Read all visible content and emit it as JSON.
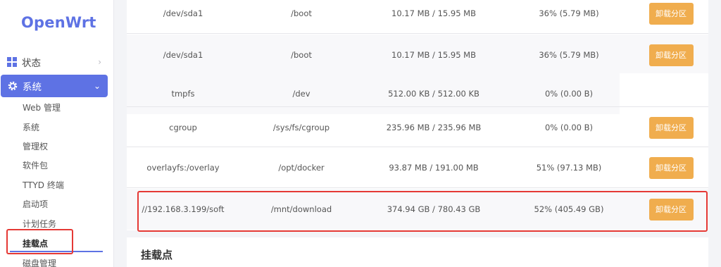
{
  "brand": "OpenWrt",
  "nav": {
    "status_label": "状态",
    "system_label": "系统",
    "sub_items": [
      "Web 管理",
      "系统",
      "管理权",
      "软件包",
      "TTYD 终端",
      "启动项",
      "计划任务",
      "挂载点",
      "磁盘管理"
    ],
    "active_sub": "挂载点"
  },
  "mounts": {
    "action_label": "卸载分区",
    "rows": [
      {
        "device": "/dev/sda1",
        "mount": "/boot",
        "usage": "10.17 MB / 15.95 MB",
        "percent": "36% (5.79 MB)",
        "has_action": true
      },
      {
        "device": "/dev/sda1",
        "mount": "/boot",
        "usage": "10.17 MB / 15.95 MB",
        "percent": "36% (5.79 MB)",
        "has_action": true
      },
      {
        "device": "tmpfs",
        "mount": "/dev",
        "usage": "512.00 KB / 512.00 KB",
        "percent": "0% (0.00 B)",
        "has_action": false
      },
      {
        "device": "cgroup",
        "mount": "/sys/fs/cgroup",
        "usage": "235.96 MB / 235.96 MB",
        "percent": "0% (0.00 B)",
        "has_action": true
      },
      {
        "device": "overlayfs:/overlay",
        "mount": "/opt/docker",
        "usage": "93.87 MB / 191.00 MB",
        "percent": "51% (97.13 MB)",
        "has_action": true
      },
      {
        "device": "//192.168.3.199/soft",
        "mount": "/mnt/download",
        "usage": "374.94 GB / 780.43 GB",
        "percent": "52% (405.49 GB)",
        "has_action": true
      }
    ]
  },
  "section": {
    "title": "挂载点"
  },
  "colors": {
    "accent": "#5e72e4",
    "warning": "#f0ad4e",
    "highlight": "#e53935"
  }
}
